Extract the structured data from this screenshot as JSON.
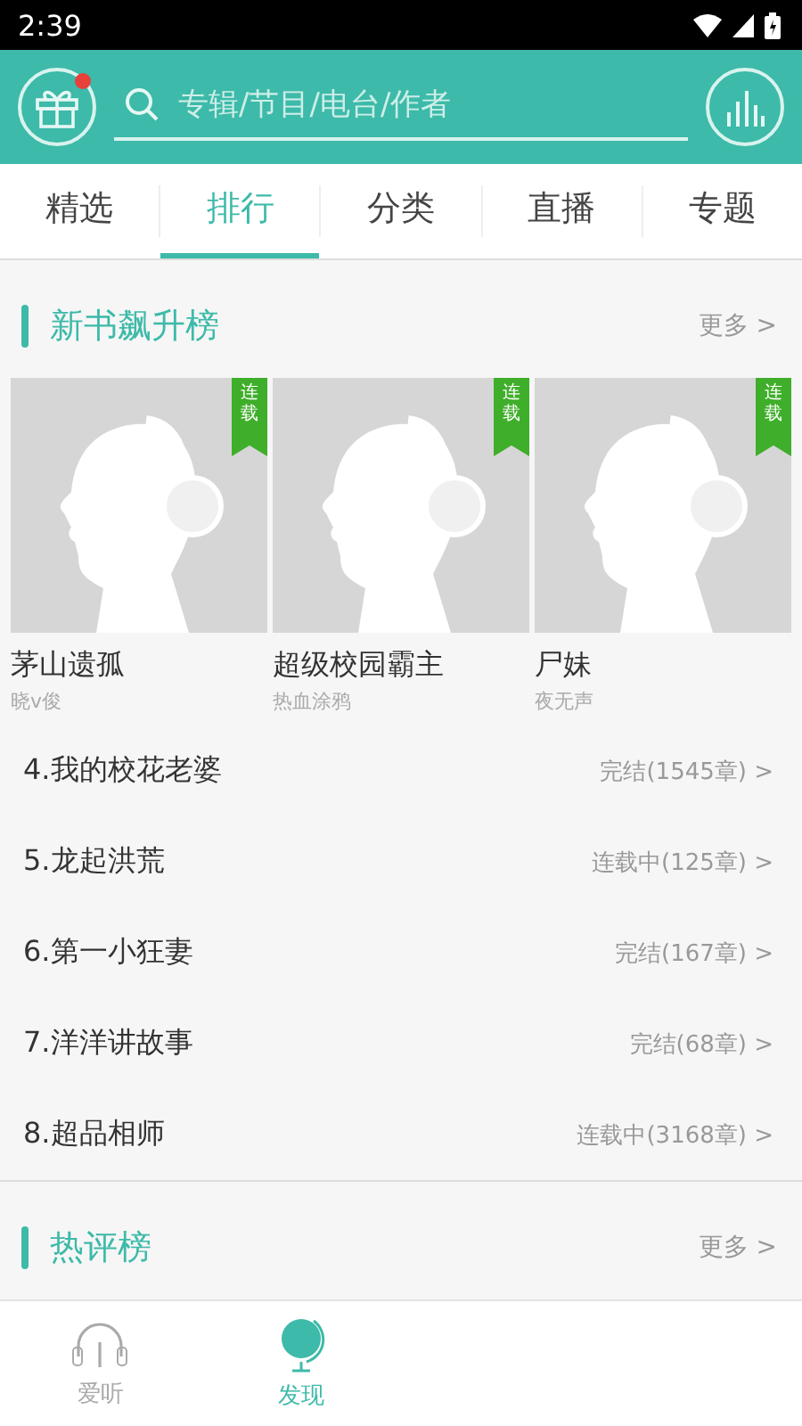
{
  "status_bar": {
    "time": "2:39"
  },
  "header": {
    "search": {
      "placeholder": "专辑/节目/电台/作者"
    },
    "gift_has_notice": true
  },
  "tabs": [
    {
      "label": "精选",
      "selected": false
    },
    {
      "label": "排行",
      "selected": true
    },
    {
      "label": "分类",
      "selected": false
    },
    {
      "label": "直播",
      "selected": false
    },
    {
      "label": "专题",
      "selected": false
    }
  ],
  "sections": [
    {
      "title": "新书飙升榜",
      "more": "更多 >",
      "cards": [
        {
          "title": "茅山遗孤",
          "author": "晓v俊",
          "badge": "连载"
        },
        {
          "title": "超级校园霸主",
          "author": "热血涂鸦",
          "badge": "连载"
        },
        {
          "title": "尸妹",
          "author": "夜无声",
          "badge": "连载"
        }
      ],
      "rows": [
        {
          "title": "4.我的校花老婆",
          "status": "完结(1545章) >"
        },
        {
          "title": "5.龙起洪荒",
          "status": "连载中(125章) >"
        },
        {
          "title": "6.第一小狂妻",
          "status": "完结(167章) >"
        },
        {
          "title": "7.洋洋讲故事",
          "status": "完结(68章) >"
        },
        {
          "title": "8.超品相师",
          "status": "连载中(3168章) >"
        }
      ]
    },
    {
      "title": "热评榜",
      "more": "更多 >"
    }
  ],
  "bottom_nav": [
    {
      "label": "爱听",
      "kind": "headphones",
      "selected": false
    },
    {
      "label": "发现",
      "kind": "globe",
      "selected": true
    }
  ]
}
